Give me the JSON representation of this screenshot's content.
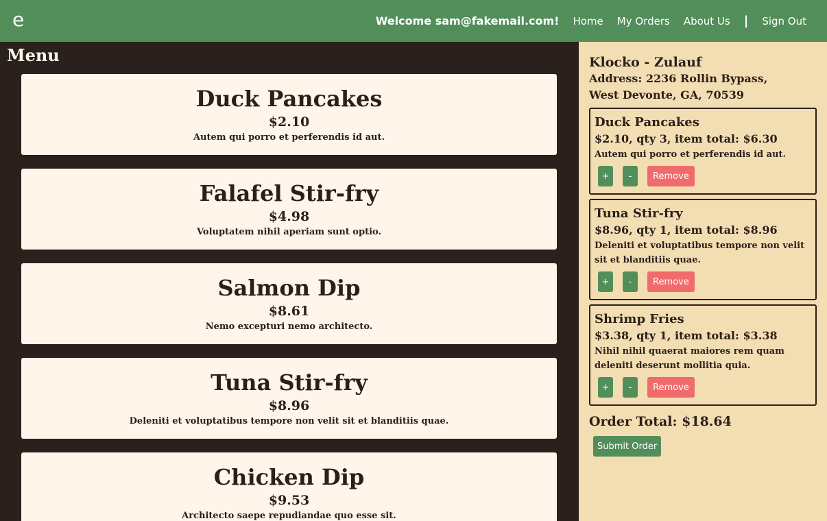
{
  "nav": {
    "logo": "e",
    "welcome": "Welcome sam@fakemail.com!",
    "links": [
      "Home",
      "My Orders",
      "About Us"
    ],
    "separator": "|",
    "sign_out": "Sign Out",
    "bg_color": "#528e5a"
  },
  "menu": {
    "title": "Menu",
    "items": [
      {
        "name": "Duck Pancakes",
        "price": "$2.10",
        "desc": "Autem qui porro et perferendis id aut."
      },
      {
        "name": "Falafel Stir-fry",
        "price": "$4.98",
        "desc": "Voluptatem nihil aperiam sunt optio."
      },
      {
        "name": "Salmon Dip",
        "price": "$8.61",
        "desc": "Nemo excepturi nemo architecto."
      },
      {
        "name": "Tuna Stir-fry",
        "price": "$8.96",
        "desc": "Deleniti et voluptatibus tempore non velit sit et blanditiis quae."
      },
      {
        "name": "Chicken Dip",
        "price": "$9.53",
        "desc": "Architecto saepe repudiandae quo esse sit."
      }
    ]
  },
  "order": {
    "restaurant": "Klocko - Zulauf",
    "address": "Address: 2236 Rollin Bypass, West Devonte, GA, 70539",
    "items": [
      {
        "name": "Duck Pancakes",
        "summary": "$2.10, qty 3, item total: $6.30",
        "desc": "Autem qui porro et perferendis id aut."
      },
      {
        "name": "Tuna Stir-fry",
        "summary": "$8.96, qty 1, item total: $8.96",
        "desc": "Deleniti et voluptatibus tempore non velit sit et blanditiis quae."
      },
      {
        "name": "Shrimp Fries",
        "summary": "$3.38, qty 1, item total: $3.38",
        "desc": "Nihil nihil quaerat maiores rem quam deleniti deserunt mollitia quia."
      }
    ],
    "plus_label": "+",
    "minus_label": "-",
    "remove_label": "Remove",
    "total": "Order Total: $18.64",
    "submit_label": "Submit Order"
  }
}
